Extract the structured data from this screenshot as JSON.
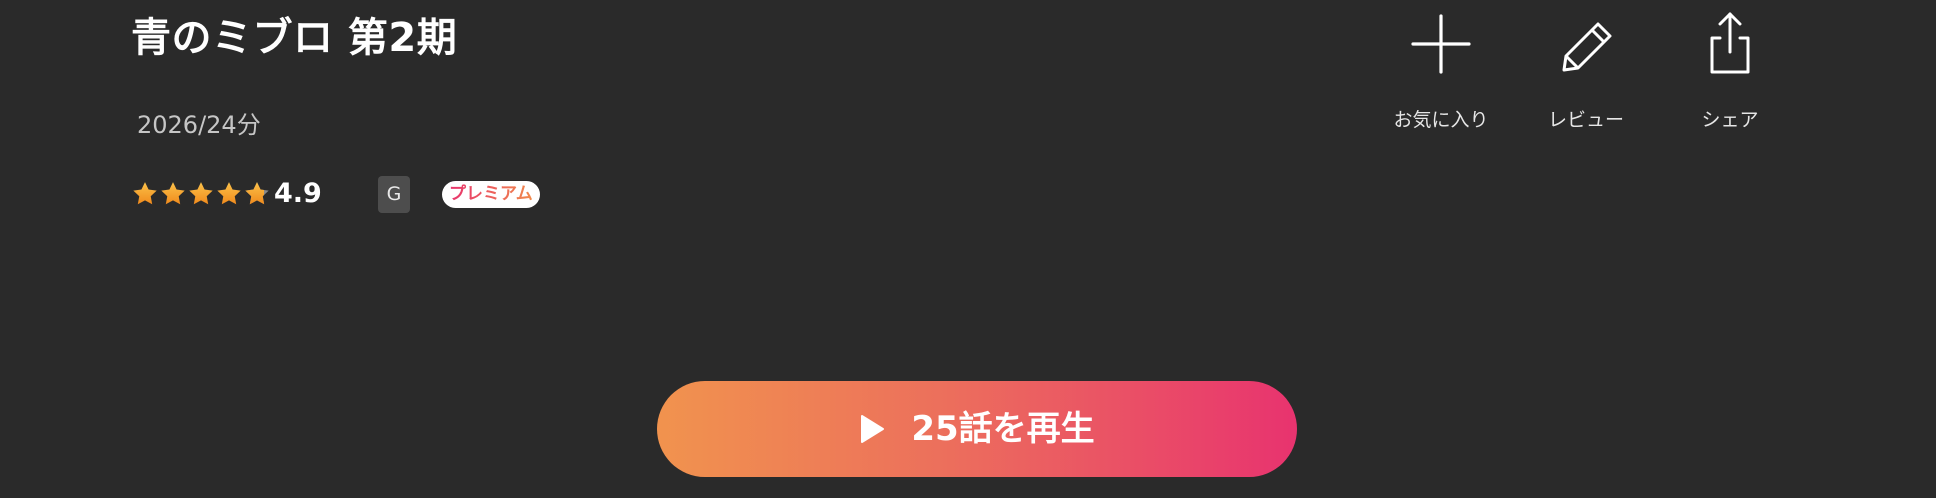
{
  "title": "青のミブロ 第2期",
  "meta": "2026/24分",
  "rating": {
    "value_label": "4.9",
    "value": 4.9,
    "max": 5,
    "star_color": "#f6a623"
  },
  "age_rating": "G",
  "premium_label": "プレミアム",
  "actions": {
    "favorite": {
      "label": "お気に入り",
      "icon": "plus-icon"
    },
    "review": {
      "label": "レビュー",
      "icon": "pencil-icon"
    },
    "share": {
      "label": "シェア",
      "icon": "share-icon"
    }
  },
  "play_button": {
    "label": "25話を再生",
    "icon": "play-icon",
    "gradient": [
      "#f1934e",
      "#e8336f"
    ]
  },
  "colors": {
    "background": "#2a2a2a",
    "text": "#ffffff",
    "muted": "#c6c6c6"
  }
}
